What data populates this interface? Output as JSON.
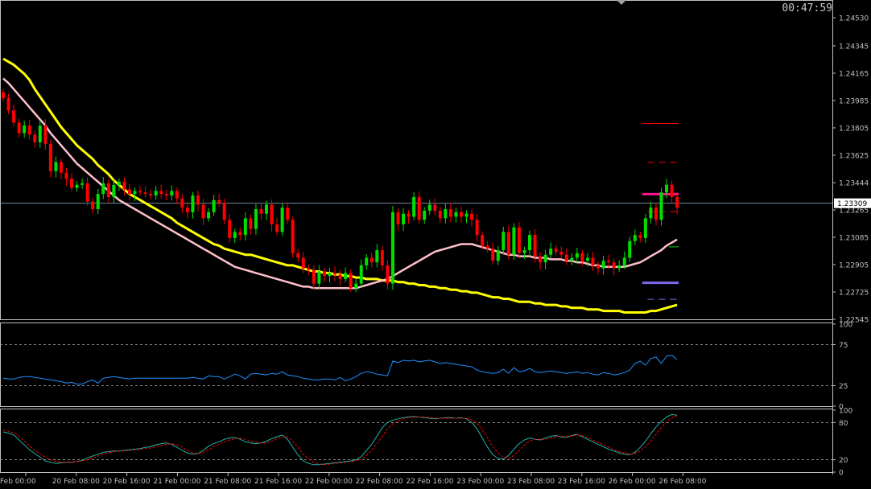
{
  "header": {
    "timer": "00:47:59"
  },
  "colors": {
    "background": "#000000",
    "axis": "#c0c0c0",
    "candle_up": "#00e000",
    "candle_down": "#ff0000",
    "ma_slow": "#ffff00",
    "ma_fast": "#ffc0cb",
    "rsi": "#1e90ff",
    "stoch_main": "#20b2aa",
    "stoch_signal": "#ff0000",
    "level_magenta": "#ff1493",
    "level_blue": "#7b68ee",
    "level_green": "#00cc00",
    "level_red": "#ff0000"
  },
  "chart_data": [
    {
      "type": "candlestick",
      "panel": "price",
      "ylim": [
        1.22545,
        1.24636
      ],
      "yticks": [
        "1.24530",
        "1.24345",
        "1.24165",
        "1.23985",
        "1.23805",
        "1.23625",
        "1.23444",
        "1.23265",
        "1.23085",
        "1.22905",
        "1.22725",
        "1.22545"
      ],
      "yticks_values": [
        1.2453,
        1.24345,
        1.24165,
        1.23985,
        1.23805,
        1.23625,
        1.23444,
        1.23265,
        1.23085,
        1.22905,
        1.22725,
        1.22545
      ],
      "current_price_label": "1.23309",
      "current_price": 1.23309,
      "x_labels": [
        "Feb 00:00",
        "20 Feb 08:00",
        "20 Feb 16:00",
        "21 Feb 00:00",
        "21 Feb 08:00",
        "21 Feb 16:00",
        "22 Feb 00:00",
        "22 Feb 08:00",
        "22 Feb 16:00",
        "23 Feb 00:00",
        "23 Feb 08:00",
        "23 Feb 16:00",
        "26 Feb 00:00",
        "26 Feb 08:00"
      ],
      "close": [
        1.24,
        1.2392,
        1.2384,
        1.2377,
        1.2382,
        1.2376,
        1.2371,
        1.2382,
        1.237,
        1.2352,
        1.2358,
        1.2351,
        1.2347,
        1.2341,
        1.2343,
        1.2344,
        1.2332,
        1.2327,
        1.2337,
        1.2344,
        1.2335,
        1.2343,
        1.2345,
        1.234,
        1.2337,
        1.2339,
        1.2338,
        1.2337,
        1.2336,
        1.2339,
        1.2337,
        1.2336,
        1.2339,
        1.2334,
        1.2328,
        1.2325,
        1.2336,
        1.233,
        1.2321,
        1.2325,
        1.2333,
        1.2331,
        1.232,
        1.2308,
        1.2312,
        1.231,
        1.2321,
        1.2314,
        1.2327,
        1.2324,
        1.233,
        1.2317,
        1.2312,
        1.2328,
        1.232,
        1.2298,
        1.2295,
        1.2288,
        1.2287,
        1.2278,
        1.2286,
        1.2283,
        1.2285,
        1.2284,
        1.2281,
        1.2285,
        1.2275,
        1.2278,
        1.229,
        1.2295,
        1.2292,
        1.23,
        1.229,
        1.2278,
        1.2325,
        1.2317,
        1.2324,
        1.2322,
        1.2335,
        1.232,
        1.2326,
        1.233,
        1.2326,
        1.2321,
        1.2327,
        1.2322,
        1.2325,
        1.2322,
        1.2324,
        1.232,
        1.231,
        1.2303,
        1.2301,
        1.2293,
        1.23,
        1.2312,
        1.2297,
        1.2315,
        1.2298,
        1.23,
        1.231,
        1.2296,
        1.2292,
        1.2297,
        1.2301,
        1.2299,
        1.2297,
        1.2293,
        1.2295,
        1.2298,
        1.2293,
        1.2295,
        1.229,
        1.2288,
        1.2293,
        1.2292,
        1.2288,
        1.229,
        1.2295,
        1.2306,
        1.231,
        1.2308,
        1.2321,
        1.2328,
        1.232,
        1.2338,
        1.2343,
        1.2335,
        1.2328
      ],
      "series": [
        {
          "name": "MA slow",
          "values": [
            1.2426,
            1.2424,
            1.2422,
            1.2419,
            1.2416,
            1.2412,
            1.2406,
            1.2401,
            1.2396,
            1.2391,
            1.2386,
            1.2381,
            1.2377,
            1.2373,
            1.2369,
            1.2366,
            1.2363,
            1.236,
            1.2356,
            1.2353,
            1.235,
            1.2346,
            1.2343,
            1.234,
            1.2337,
            1.2335,
            1.2333,
            1.2331,
            1.2329,
            1.2327,
            1.2325,
            1.2323,
            1.2321,
            1.2318,
            1.2316,
            1.2314,
            1.2312,
            1.231,
            1.2308,
            1.2306,
            1.2304,
            1.2303,
            1.2301,
            1.23,
            1.2299,
            1.2298,
            1.2297,
            1.2297,
            1.2296,
            1.2295,
            1.2294,
            1.2293,
            1.2292,
            1.2291,
            1.229,
            1.229,
            1.2289,
            1.2288,
            1.2287,
            1.2286,
            1.2286,
            1.2285,
            1.2285,
            1.2284,
            1.2284,
            1.2283,
            1.2283,
            1.2282,
            1.2282,
            1.2281,
            1.2281,
            1.2281,
            1.228,
            1.228,
            1.228,
            1.2279,
            1.2279,
            1.2278,
            1.2278,
            1.2277,
            1.2277,
            1.2276,
            1.2276,
            1.2275,
            1.2275,
            1.2274,
            1.2274,
            1.2273,
            1.2273,
            1.2272,
            1.2272,
            1.2271,
            1.227,
            1.2269,
            1.2269,
            1.2268,
            1.2268,
            1.2267,
            1.2266,
            1.2266,
            1.2266,
            1.2265,
            1.2265,
            1.2264,
            1.2264,
            1.2264,
            1.2263,
            1.2263,
            1.2262,
            1.2262,
            1.2262,
            1.2261,
            1.2261,
            1.2261,
            1.226,
            1.226,
            1.226,
            1.226,
            1.2259,
            1.2259,
            1.2259,
            1.2259,
            1.2259,
            1.226,
            1.226,
            1.2261,
            1.2262,
            1.2263,
            1.2264
          ]
        },
        {
          "name": "MA fast",
          "values": [
            1.2413,
            1.241,
            1.2406,
            1.2402,
            1.2398,
            1.2394,
            1.239,
            1.2386,
            1.2382,
            1.2377,
            1.2373,
            1.2369,
            1.2365,
            1.2361,
            1.2357,
            1.2354,
            1.2351,
            1.2348,
            1.2345,
            1.2342,
            1.2339,
            1.2336,
            1.2333,
            1.2331,
            1.2329,
            1.2327,
            1.2325,
            1.2323,
            1.2321,
            1.2319,
            1.2317,
            1.2315,
            1.2313,
            1.2311,
            1.2309,
            1.2307,
            1.2305,
            1.2303,
            1.2301,
            1.2299,
            1.2297,
            1.2295,
            1.2293,
            1.2291,
            1.2289,
            1.2288,
            1.2287,
            1.2286,
            1.2285,
            1.2284,
            1.2283,
            1.2282,
            1.2281,
            1.228,
            1.2279,
            1.2278,
            1.2277,
            1.2276,
            1.2276,
            1.2275,
            1.2275,
            1.2275,
            1.2275,
            1.2275,
            1.2275,
            1.2275,
            1.2275,
            1.2275,
            1.2276,
            1.2277,
            1.2278,
            1.2279,
            1.228,
            1.2281,
            1.2283,
            1.2285,
            1.2287,
            1.2289,
            1.2291,
            1.2293,
            1.2295,
            1.2297,
            1.2299,
            1.23,
            1.2301,
            1.2302,
            1.2303,
            1.2304,
            1.2304,
            1.2304,
            1.2303,
            1.2302,
            1.2301,
            1.23,
            1.2299,
            1.2298,
            1.2297,
            1.2297,
            1.2296,
            1.2296,
            1.2296,
            1.2295,
            1.2295,
            1.2295,
            1.2294,
            1.2294,
            1.2294,
            1.2293,
            1.2293,
            1.2292,
            1.2292,
            1.2291,
            1.229,
            1.229,
            1.2289,
            1.2289,
            1.2289,
            1.2289,
            1.2289,
            1.229,
            1.2291,
            1.2292,
            1.2294,
            1.2296,
            1.2298,
            1.23,
            1.2303,
            1.2305,
            1.2307
          ]
        }
      ],
      "levels": [
        {
          "price": 1.23834,
          "style": "solid-thin",
          "color": "level_red",
          "from_candle": 122
        },
        {
          "price": 1.23578,
          "style": "dashed",
          "color": "level_red",
          "from_candle": 123
        },
        {
          "price": 1.23369,
          "style": "solid-thick",
          "color": "level_magenta",
          "from_candle": 122
        },
        {
          "price": 1.23254,
          "style": "dashed",
          "color": "level_red",
          "from_candle": 123
        },
        {
          "price": 1.23022,
          "style": "solid-thin",
          "color": "level_green",
          "from_candle": 127
        },
        {
          "price": 1.22785,
          "style": "solid-thick",
          "color": "level_blue",
          "from_candle": 122
        },
        {
          "price": 1.22677,
          "style": "dashed",
          "color": "level_blue",
          "from_candle": 123
        }
      ]
    },
    {
      "type": "line",
      "panel": "rsi",
      "ylim": [
        0,
        100
      ],
      "yticks": [
        "100",
        "75",
        "25",
        "0"
      ],
      "yticks_values": [
        100,
        75,
        25,
        0
      ],
      "levels": [
        75,
        25
      ],
      "series": [
        {
          "name": "RSI",
          "values": [
            34,
            33,
            33,
            35,
            36,
            36,
            35,
            34,
            33,
            32,
            31,
            30,
            28,
            29,
            27,
            27,
            30,
            32,
            28,
            34,
            35,
            36,
            35,
            34,
            33,
            34,
            34,
            34,
            34,
            34,
            34,
            34,
            34,
            34,
            34,
            34,
            35,
            34,
            33,
            37,
            36,
            36,
            33,
            36,
            39,
            37,
            33,
            39,
            40,
            39,
            38,
            40,
            39,
            42,
            38,
            37,
            36,
            34,
            33,
            32,
            32,
            33,
            33,
            32,
            35,
            31,
            33,
            36,
            40,
            42,
            41,
            39,
            38,
            37,
            55,
            53,
            56,
            55,
            56,
            54,
            55,
            56,
            54,
            52,
            53,
            52,
            51,
            50,
            49,
            48,
            44,
            42,
            41,
            40,
            41,
            45,
            40,
            47,
            42,
            43,
            46,
            42,
            41,
            42,
            43,
            42,
            41,
            40,
            41,
            42,
            40,
            41,
            39,
            38,
            41,
            40,
            38,
            39,
            41,
            44,
            52,
            55,
            50,
            58,
            60,
            52,
            61,
            62,
            57
          ]
        }
      ]
    },
    {
      "type": "line",
      "panel": "stochastic",
      "ylim": [
        0,
        100
      ],
      "yticks": [
        "100",
        "80",
        "20",
        "0"
      ],
      "yticks_values": [
        100,
        80,
        20,
        0
      ],
      "levels": [
        80,
        20
      ],
      "series": [
        {
          "name": "Stochastic main",
          "values": [
            65,
            63,
            60,
            52,
            44,
            36,
            30,
            24,
            18,
            16,
            14,
            15,
            16,
            16,
            17,
            19,
            23,
            26,
            29,
            32,
            33,
            34,
            34,
            35,
            36,
            37,
            38,
            40,
            41,
            44,
            46,
            47,
            45,
            40,
            35,
            31,
            29,
            30,
            35,
            42,
            46,
            49,
            53,
            55,
            56,
            53,
            49,
            47,
            46,
            47,
            50,
            54,
            57,
            60,
            53,
            40,
            28,
            18,
            14,
            12,
            12,
            13,
            14,
            15,
            16,
            17,
            18,
            20,
            25,
            35,
            45,
            58,
            72,
            80,
            84,
            86,
            88,
            89,
            90,
            89,
            88,
            87,
            86,
            87,
            88,
            88,
            87,
            88,
            86,
            80,
            70,
            55,
            40,
            28,
            22,
            21,
            27,
            37,
            46,
            52,
            55,
            53,
            52,
            55,
            58,
            59,
            57,
            56,
            59,
            61,
            57,
            53,
            49,
            45,
            41,
            37,
            34,
            31,
            29,
            28,
            32,
            40,
            50,
            62,
            73,
            82,
            89,
            93,
            92
          ]
        },
        {
          "name": "Stochastic signal",
          "values": [
            68,
            66,
            63,
            58,
            50,
            42,
            35,
            29,
            24,
            20,
            17,
            16,
            16,
            16,
            17,
            18,
            20,
            23,
            26,
            29,
            31,
            33,
            34,
            34,
            35,
            36,
            37,
            38,
            39,
            41,
            43,
            45,
            46,
            44,
            40,
            35,
            31,
            30,
            32,
            36,
            41,
            45,
            49,
            52,
            54,
            55,
            53,
            50,
            48,
            47,
            47,
            50,
            54,
            57,
            57,
            50,
            40,
            29,
            21,
            16,
            13,
            12,
            13,
            14,
            15,
            16,
            17,
            18,
            21,
            27,
            36,
            46,
            58,
            70,
            78,
            83,
            86,
            88,
            89,
            89,
            89,
            88,
            87,
            87,
            87,
            87,
            87,
            87,
            87,
            84,
            79,
            68,
            55,
            41,
            31,
            24,
            22,
            27,
            35,
            44,
            50,
            53,
            53,
            53,
            55,
            57,
            58,
            57,
            58,
            60,
            59,
            56,
            52,
            48,
            44,
            40,
            36,
            33,
            31,
            29,
            30,
            34,
            41,
            50,
            61,
            72,
            81,
            88,
            91
          ]
        }
      ]
    }
  ]
}
